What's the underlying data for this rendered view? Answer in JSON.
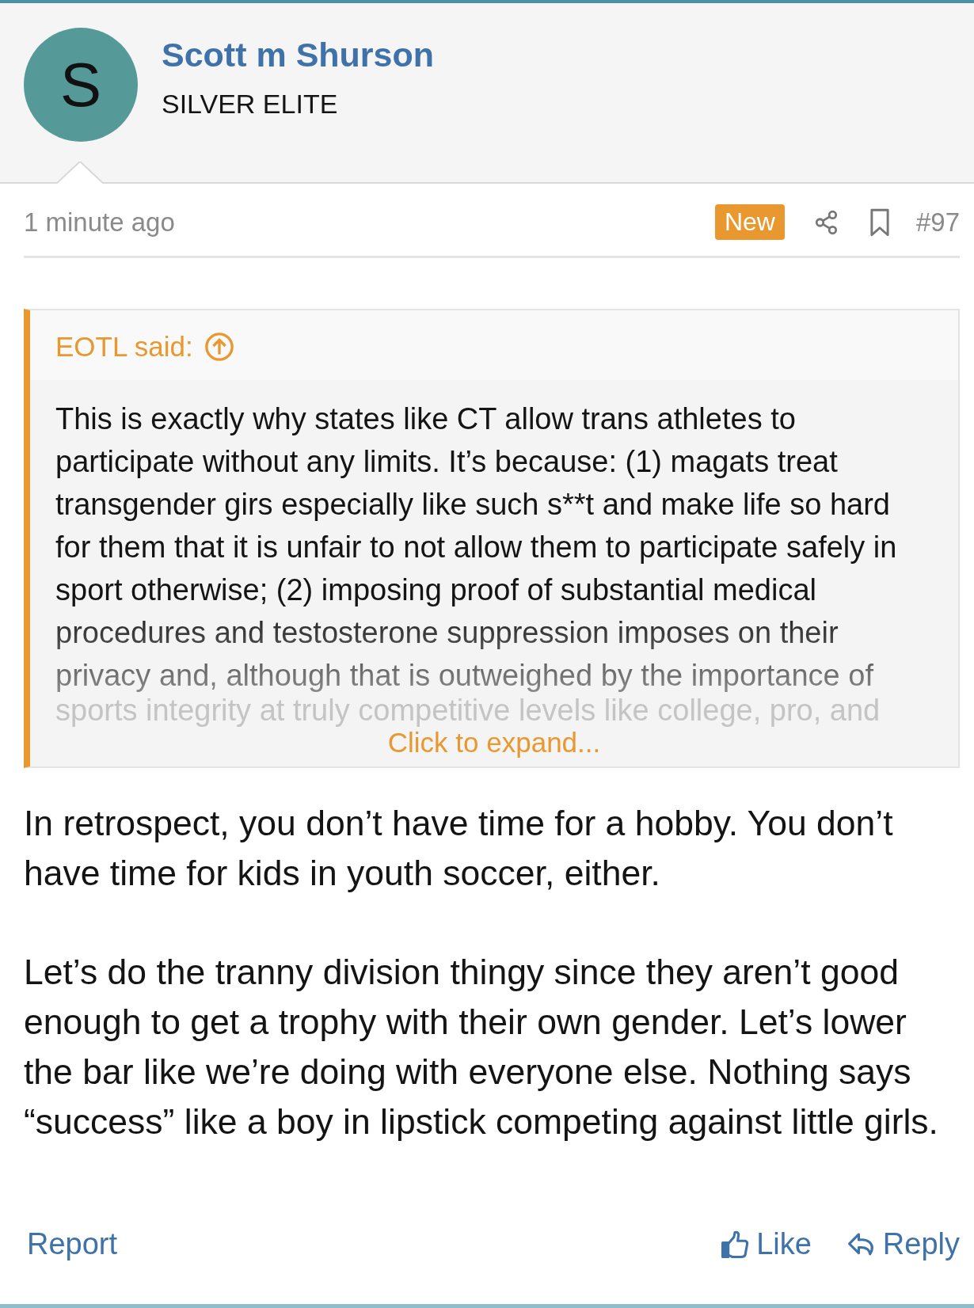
{
  "author": {
    "avatar_letter": "S",
    "name": "Scott m Shurson",
    "rank": "SILVER ELITE"
  },
  "meta": {
    "time": "1 minute ago",
    "badge": "New",
    "post_number": "#97"
  },
  "quote": {
    "attribution": "EOTL said:",
    "text": "This is exactly why states like CT allow trans athletes to participate without any limits. It’s because: (1) magats treat transgender girs especially like such s**t and make life so hard for them that it is unfair to not allow them to participate safely in sport otherwise; (2) imposing proof of substantial medical procedures and testosterone suppression imposes on their privacy and, although that is outweighed by the importance of",
    "cut_line": "sports integrity at truly competitive levels like college, pro, and",
    "expand": "Click to expand..."
  },
  "body": [
    "In retrospect, you don’t have time for a hobby. You don’t have time for kids in youth soccer, either.",
    "Let’s do the tranny division thingy since they aren’t good enough to get a trophy with their own gender. Let’s lower the bar like we’re doing with everyone else. Nothing says “success” like a boy in lipstick competing against little girls."
  ],
  "footer": {
    "report": "Report",
    "like": "Like",
    "reply": "Reply"
  }
}
